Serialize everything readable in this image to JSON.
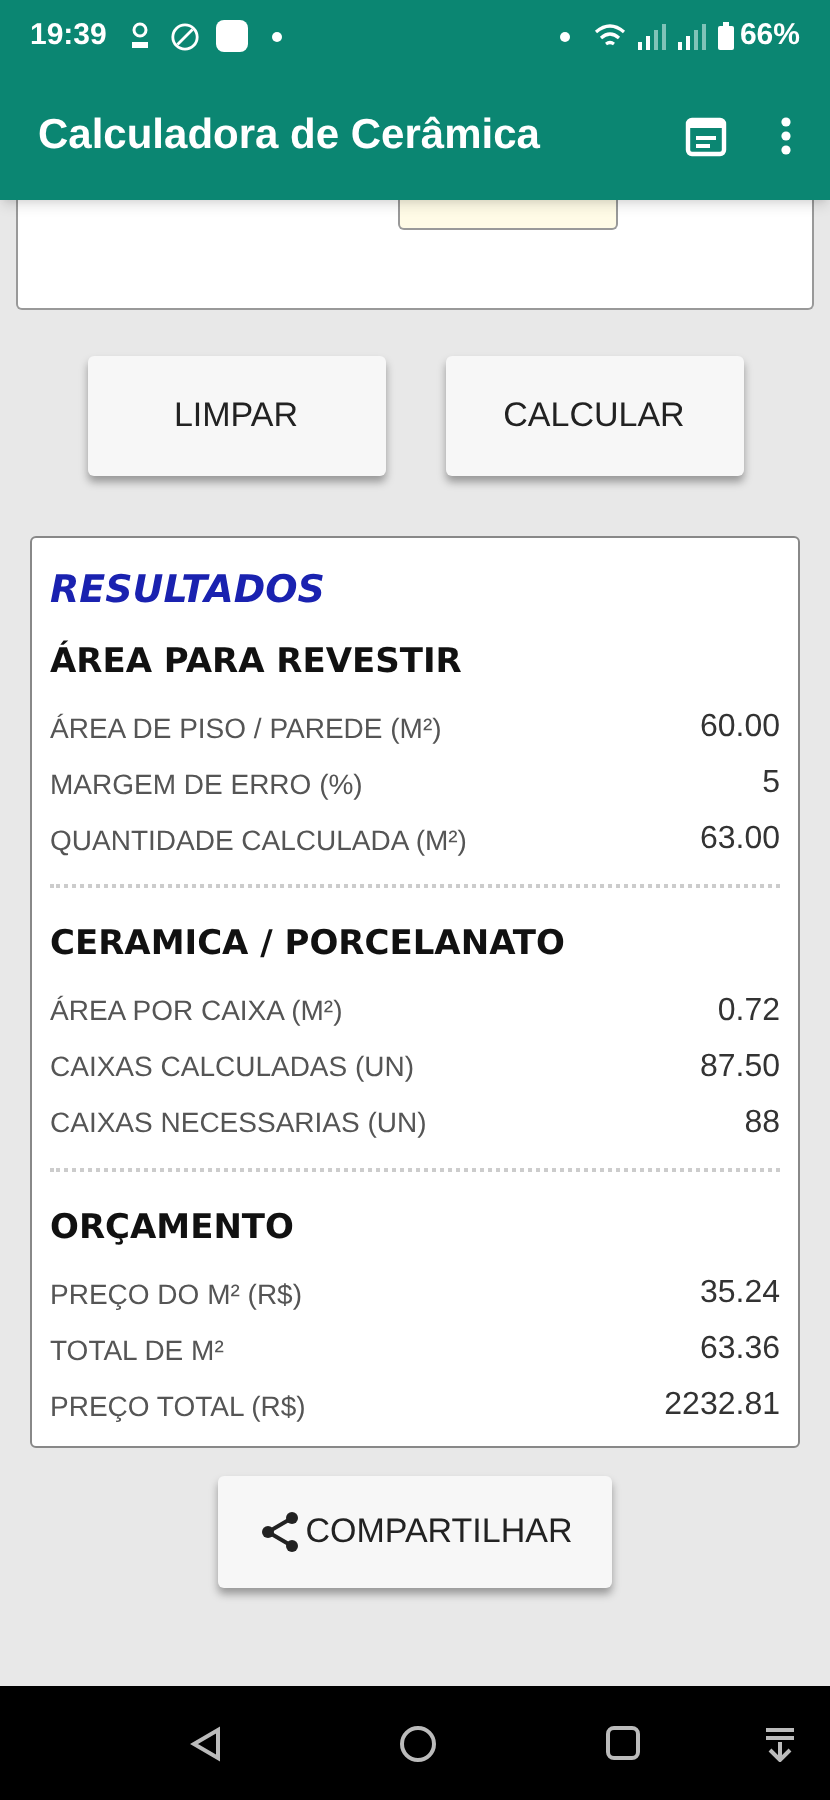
{
  "status_bar": {
    "time": "19:39",
    "battery": "66%"
  },
  "app_bar": {
    "title": "Calculadora de Cerâmica"
  },
  "buttons": [
    {
      "label": "LIMPAR"
    },
    {
      "label": "CALCULAR"
    }
  ],
  "results": {
    "title": "RESULTADOS",
    "sections": [
      {
        "heading": "ÁREA PARA REVESTIR",
        "rows": [
          {
            "label": "ÁREA DE PISO / PAREDE (M²)",
            "value": "60.00"
          },
          {
            "label": "MARGEM DE ERRO (%)",
            "value": "5"
          },
          {
            "label": "QUANTIDADE CALCULADA (M²)",
            "value": "63.00"
          }
        ]
      },
      {
        "heading": "CERAMICA / PORCELANATO",
        "rows": [
          {
            "label": "ÁREA POR CAIXA (M²)",
            "value": "0.72"
          },
          {
            "label": "CAIXAS CALCULADAS (UN)",
            "value": "87.50"
          },
          {
            "label": "CAIXAS NECESSARIAS (UN)",
            "value": "88"
          }
        ]
      },
      {
        "heading": "ORÇAMENTO",
        "rows": [
          {
            "label": "PREÇO DO M² (R$)",
            "value": "35.24"
          },
          {
            "label": "TOTAL DE M²",
            "value": "63.36"
          },
          {
            "label": "PREÇO TOTAL (R$)",
            "value": "2232.81"
          }
        ]
      }
    ]
  },
  "share_button": {
    "label": "COMPARTILHAR"
  }
}
